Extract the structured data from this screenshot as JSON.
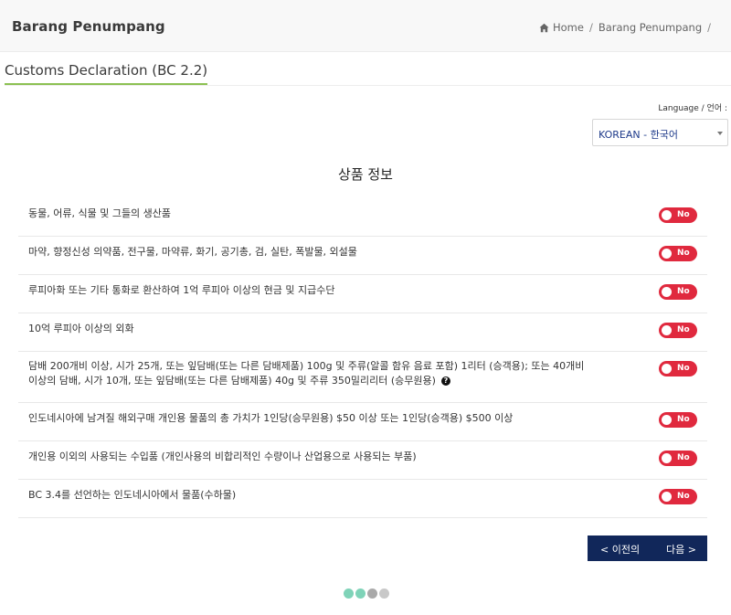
{
  "header": {
    "title": "Barang Penumpang",
    "breadcrumb": {
      "home": "Home",
      "current": "Barang Penumpang",
      "sep": "/"
    }
  },
  "section": {
    "title": "Customs Declaration (BC 2.2)"
  },
  "language": {
    "label": "Language / 언어 :",
    "selected": "KOREAN - 한국어"
  },
  "form": {
    "title": "상품 정보",
    "toggle_label": "No",
    "items": [
      {
        "text": "동물, 어류, 식물 및 그들의 생산품"
      },
      {
        "text": "마약, 향정신성 의약품, 전구물, 마약류, 화기, 공기총, 검, 실탄, 폭발물, 외설물"
      },
      {
        "text": "루피아화 또는 기타 통화로 환산하여 1억 루피아 이상의 현금 및 지급수단"
      },
      {
        "text": "10억 루피아 이상의 외화"
      },
      {
        "text": "담배 200개비 이상, 시가 25개, 또는 잎담배(또는 다른 담배제품) 100g 및 주류(알콜 함유 음료 포함) 1리터 (승객용); 또는 40개비 이상의 담배, 시가 10개, 또는 잎담배(또는 다른 담배제품) 40g 및 주류 350밀리리터 (승무원용)"
      },
      {
        "text": "인도네시아에 남겨질 해외구매 개인용 물품의 총 가치가 1인당(승무원용) $50 이상 또는 1인당(승객용) $500 이상"
      },
      {
        "text": "개인용 이외의 사용되는 수입품 (개인사용의 비합리적인 수량이나 산업용으로 사용되는 부품)"
      },
      {
        "text": "BC 3.4를 선언하는 인도네시아에서 물품(수하물)"
      }
    ]
  },
  "nav": {
    "prev": "< 이전의",
    "next": "다음 >"
  },
  "steps": {
    "total": 4,
    "completed": 2,
    "colors": {
      "done": "#7fd3b8",
      "todo": "#c8c8c8",
      "current": "#a9a9a9"
    }
  },
  "colors": {
    "toggle_off": "#e0293e",
    "nav_bg": "#11275a",
    "accent": "#8cc152"
  }
}
